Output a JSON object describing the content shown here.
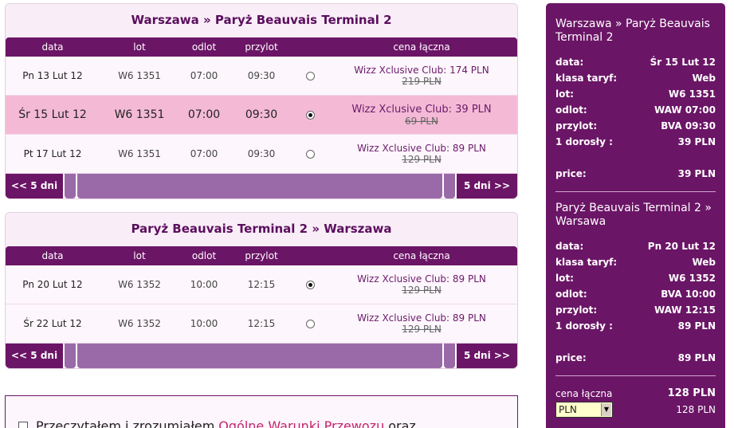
{
  "outbound": {
    "title": "Warszawa » Paryż Beauvais Terminal 2",
    "headers": [
      "data",
      "lot",
      "odlot",
      "przylot",
      "cena łączna"
    ],
    "rows": [
      {
        "date": "Pn 13 Lut 12",
        "flight": "W6 1351",
        "dep": "07:00",
        "arr": "09:30",
        "fare": "Wizz Xclusive Club: 174 PLN",
        "old": "219 PLN",
        "selected": false
      },
      {
        "date": "Śr 15 Lut 12",
        "flight": "W6 1351",
        "dep": "07:00",
        "arr": "09:30",
        "fare": "Wizz Xclusive Club: 39 PLN",
        "old": "69 PLN",
        "selected": true
      },
      {
        "date": "Pt 17 Lut 12",
        "flight": "W6 1351",
        "dep": "07:00",
        "arr": "09:30",
        "fare": "Wizz Xclusive Club: 89 PLN",
        "old": "129 PLN",
        "selected": false
      }
    ],
    "prev_label": "<< 5 dni",
    "next_label": "5 dni >>"
  },
  "inbound": {
    "title": "Paryż Beauvais Terminal 2 » Warszawa",
    "headers": [
      "data",
      "lot",
      "odlot",
      "przylot",
      "cena łączna"
    ],
    "rows": [
      {
        "date": "Pn 20 Lut 12",
        "flight": "W6 1352",
        "dep": "10:00",
        "arr": "12:15",
        "fare": "Wizz Xclusive Club: 89 PLN",
        "old": "129 PLN",
        "selected": true
      },
      {
        "date": "Śr 22 Lut 12",
        "flight": "W6 1352",
        "dep": "10:00",
        "arr": "12:15",
        "fare": "Wizz Xclusive Club: 89 PLN",
        "old": "129 PLN",
        "selected": false
      }
    ],
    "prev_label": "<< 5 dni",
    "next_label": "5 dni >>"
  },
  "terms": {
    "text_before": "Przeczytałem i zrozumiałem",
    "link": "Ogólne Warunki Przewozu",
    "text_after": "oraz"
  },
  "summary": {
    "outbound": {
      "title": "Warszawa » Paryż Beauvais Terminal 2",
      "rows": [
        {
          "k": "data:",
          "v": "Śr 15 Lut 12"
        },
        {
          "k": "klasa taryf:",
          "v": "Web"
        },
        {
          "k": "lot:",
          "v": "W6 1351"
        },
        {
          "k": "odlot:",
          "v": "WAW 07:00"
        },
        {
          "k": "przylot:",
          "v": "BVA 09:30"
        },
        {
          "k": "1 dorosły :",
          "v": "39 PLN"
        }
      ],
      "price_label": "price:",
      "price": "39 PLN"
    },
    "inbound": {
      "title": "Paryż Beauvais Terminal 2 » Warsawa",
      "rows": [
        {
          "k": "data:",
          "v": "Pn 20 Lut 12"
        },
        {
          "k": "klasa taryf:",
          "v": "Web"
        },
        {
          "k": "lot:",
          "v": "W6 1352"
        },
        {
          "k": "odlot:",
          "v": "BVA 10:00"
        },
        {
          "k": "przylot:",
          "v": "WAW 12:15"
        },
        {
          "k": "1 dorosły :",
          "v": "89 PLN"
        }
      ],
      "price_label": "price:",
      "price": "89 PLN"
    },
    "total_label": "cena łączna",
    "total": "128 PLN",
    "currency": "PLN",
    "total_converted": "128 PLN"
  }
}
